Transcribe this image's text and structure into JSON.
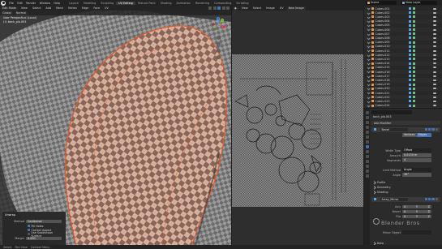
{
  "app": {
    "menu": [
      "File",
      "Edit",
      "Render",
      "Window",
      "Help"
    ],
    "workspaces": [
      "Layout",
      "Modeling",
      "Sculpting",
      "UV Editing",
      "Texture Paint",
      "Shading",
      "Animation",
      "Rendering",
      "Compositing",
      "Scripting"
    ],
    "active_workspace": "UV Editing",
    "scene": "Scene",
    "view_layer": "View Layer"
  },
  "viewport": {
    "mode": "Edit Mode",
    "header_items": [
      "View",
      "Select",
      "Add",
      "Mesh",
      "Vertex",
      "Edge",
      "Face",
      "UV"
    ],
    "toolbar_items": [
      "Global",
      "Normal"
    ],
    "info_line1": "User Perspective (Local)",
    "info_line2": "(1) back_pla.003",
    "gizmo": {
      "x_label": "X",
      "y_label": "Y",
      "z_label": "Z",
      "x_color": "#e74c63",
      "y_color": "#8bbd3a",
      "z_color": "#4c8ef0"
    },
    "mesh_colors": {
      "check_dark": "#6a5850",
      "check_light": "#d9c2b4",
      "tint": "#d88a6a",
      "edge": "#e25a2a"
    }
  },
  "operator_panel": {
    "title": "Unwrap",
    "method_label": "Method",
    "method_value": "Conformal",
    "options": [
      {
        "label": "Fill Holes",
        "checked": true
      },
      {
        "label": "Correct Aspect",
        "checked": true
      },
      {
        "label": "Use Subdivision Surface",
        "checked": false
      }
    ],
    "margin_label": "Margin",
    "margin_value": "0.000"
  },
  "uv_editor": {
    "header_items": [
      "View",
      "Select",
      "Image",
      "UV"
    ],
    "image_name": "New Image",
    "grid_colors": {
      "check_dark": "#5c5c5c",
      "check_light": "#8c8c8c",
      "uv_line": "#1a1a1a",
      "uv_dot": "#2a2a2a"
    }
  },
  "outliner": {
    "items": [
      "Cubes.001",
      "Cubes.002",
      "Cubes.003",
      "Cubes.004",
      "Cubes.005",
      "Cubes.006",
      "Cubes.007",
      "Cubes.008",
      "Cubes.009",
      "Cubes.010",
      "Cubes.011",
      "Cubes.012",
      "Cubes.013",
      "Cubes.014",
      "Cubes.015",
      "Cubes.016",
      "Cubes.017",
      "Cubes.018",
      "Cubes.019",
      "Cubes.020",
      "Cubes.021",
      "Cubes.022",
      "Cubes.023",
      "Cubes.024"
    ]
  },
  "properties": {
    "object_name": "back_pla.003",
    "add_modifier_label": "Add Modifier",
    "bevel": {
      "name": "Bevel",
      "affect_options": [
        "Vertices",
        "Edges"
      ],
      "affect_selected": "Edges",
      "rows": [
        {
          "label": "Width Type",
          "value": "Offset"
        },
        {
          "label": "Amount",
          "value": "0.0135 m"
        },
        {
          "label": "Segments",
          "value": "4"
        },
        {
          "label": "Limit Method",
          "value": "Angle"
        },
        {
          "label": "Angle",
          "value": "30°"
        }
      ],
      "subpanels": [
        "Profile",
        "Geometry",
        "Shading"
      ]
    },
    "mirror": {
      "name": "Array_Mirror",
      "axis_rows": [
        {
          "label": "Axis",
          "values": [
            "X",
            "Y",
            "Z"
          ]
        },
        {
          "label": "Bisect",
          "values": [
            "X",
            "Y",
            "Z"
          ]
        },
        {
          "label": "Flip",
          "values": [
            "X",
            "Y",
            "Z"
          ]
        }
      ],
      "mirror_object_label": "Mirror Object",
      "subpanels": [
        "Data"
      ]
    }
  },
  "watermark": "Blender Bros",
  "status": {
    "items": [
      "Select",
      "Pan View",
      "Context Menu"
    ]
  }
}
